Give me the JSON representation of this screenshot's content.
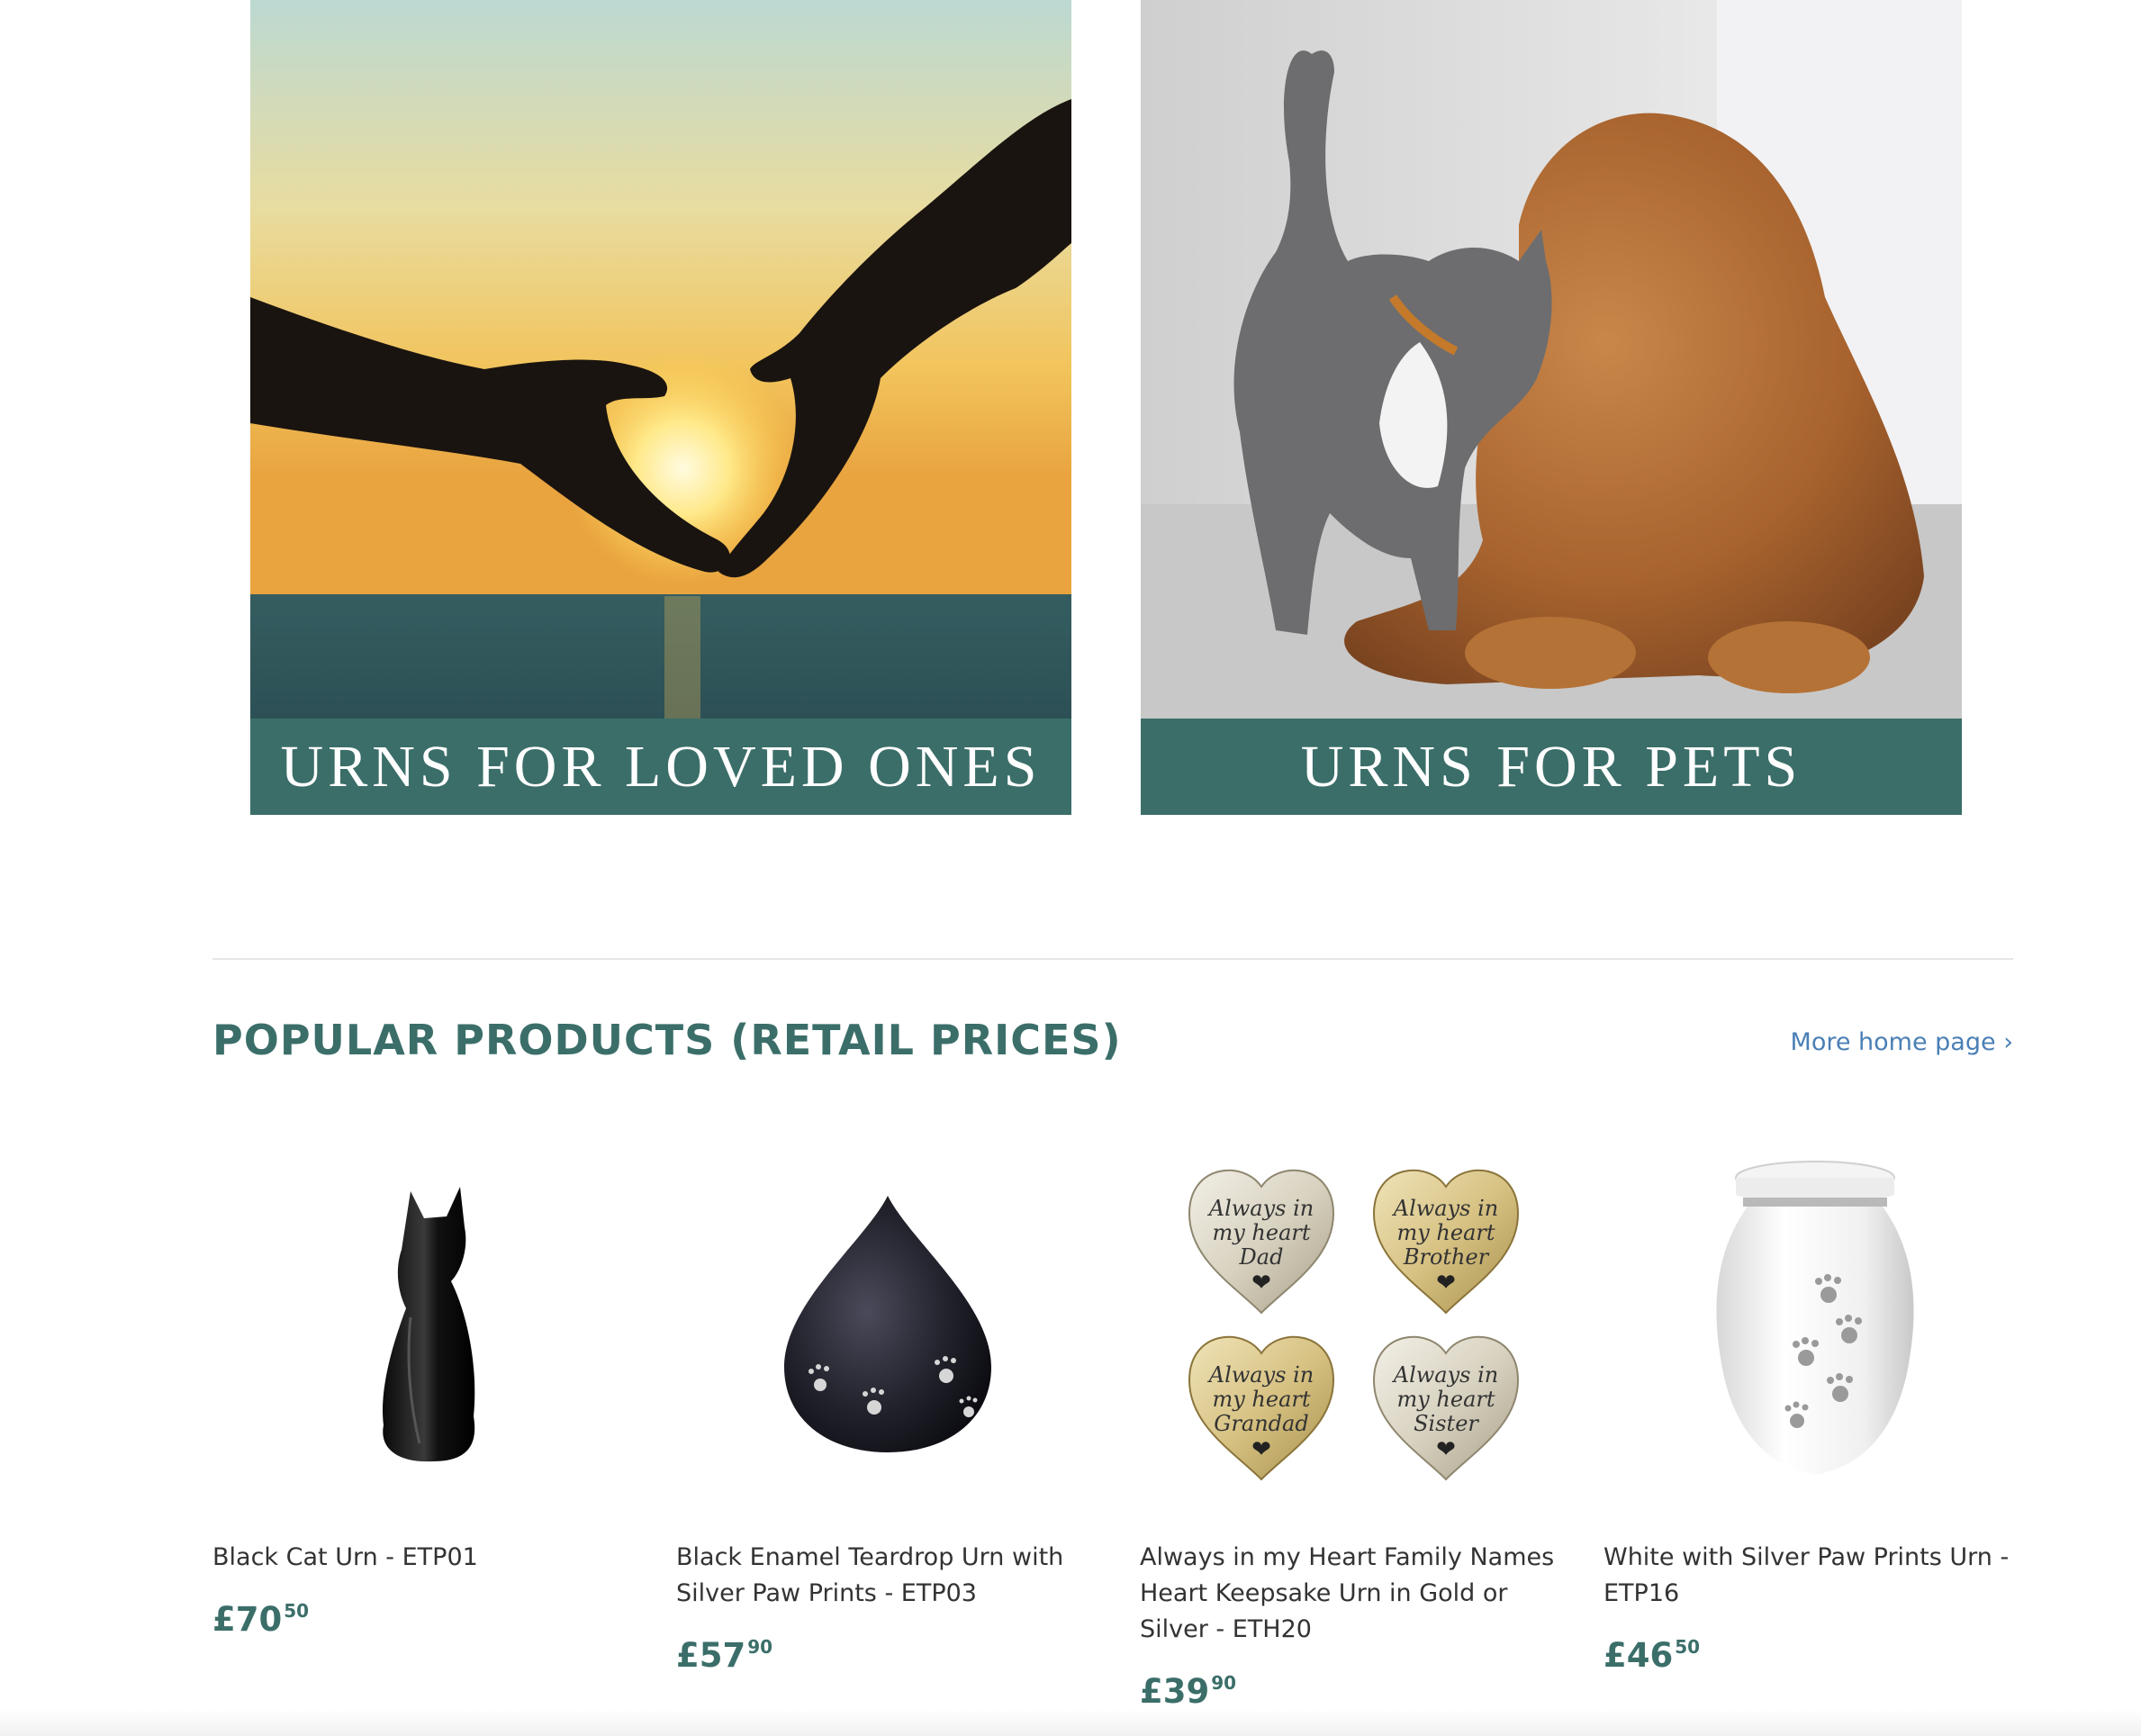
{
  "collections": [
    {
      "label": "URNS FOR LOVED ONES",
      "image": "sunset-heart-hands"
    },
    {
      "label": "URNS FOR PETS",
      "image": "cat-and-dog"
    }
  ],
  "section": {
    "title": "POPULAR PRODUCTS (RETAIL PRICES)",
    "more_link": "More home page ›"
  },
  "products": [
    {
      "title": "Black Cat Urn - ETP01",
      "price_main": "£70",
      "price_cents": "50",
      "image": "black-cat-urn"
    },
    {
      "title": "Black Enamel Teardrop Urn with Silver Paw Prints - ETP03",
      "price_main": "£57",
      "price_cents": "90",
      "image": "black-teardrop-urn"
    },
    {
      "title": "Always in my Heart Family Names Heart Keepsake Urn in Gold or Silver - ETH20",
      "price_main": "£39",
      "price_cents": "90",
      "image": "heart-keepsake-urns"
    },
    {
      "title": "White with Silver Paw Prints Urn - ETP16",
      "price_main": "£46",
      "price_cents": "50",
      "image": "white-paw-urn"
    }
  ],
  "heart_keepsakes": [
    {
      "line1": "Always in",
      "line2": "my heart",
      "line3": "Dad"
    },
    {
      "line1": "Always in",
      "line2": "my heart",
      "line3": "Brother"
    },
    {
      "line1": "Always in",
      "line2": "my heart",
      "line3": "Grandad"
    },
    {
      "line1": "Always in",
      "line2": "my heart",
      "line3": "Sister"
    }
  ],
  "colors": {
    "brand_teal": "#3b6e69",
    "link_blue": "#4a7fb5",
    "text": "#333333"
  }
}
